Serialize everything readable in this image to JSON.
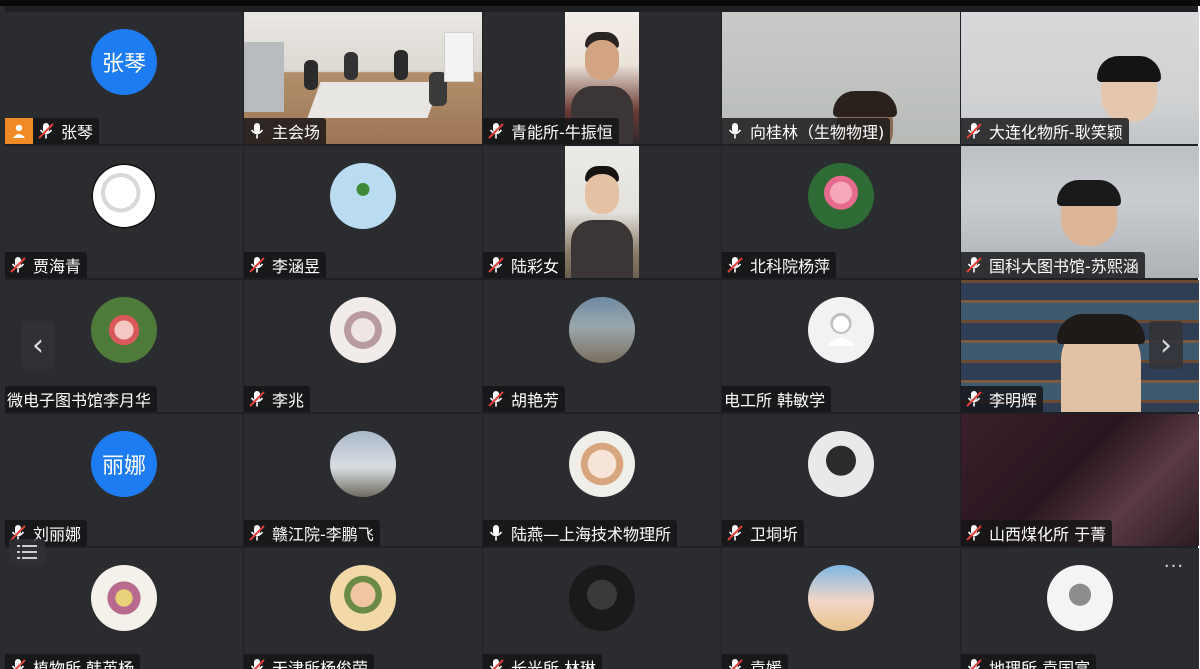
{
  "tiles": [
    {
      "name": "张琴",
      "avatar_text": "张琴",
      "mic": "muted",
      "host": true
    },
    {
      "name": "主会场",
      "mic": "on"
    },
    {
      "name": "青能所-牛振恒",
      "mic": "muted"
    },
    {
      "name": "向桂林（生物物理)",
      "mic": "on"
    },
    {
      "name": "大连化物所-耿笑颖",
      "mic": "muted"
    },
    {
      "name": "贾海青",
      "mic": "muted"
    },
    {
      "name": "李涵昱",
      "mic": "muted"
    },
    {
      "name": "陆彩女",
      "mic": "muted"
    },
    {
      "name": "北科院杨萍",
      "mic": "muted"
    },
    {
      "name": "国科大图书馆-苏熙涵",
      "mic": "muted"
    },
    {
      "name": "微电子图书馆李月华",
      "mic": "none"
    },
    {
      "name": "李兆",
      "mic": "muted"
    },
    {
      "name": "胡艳芳",
      "mic": "muted"
    },
    {
      "name": "电工所 韩敏学",
      "mic": "none"
    },
    {
      "name": "李明辉",
      "mic": "muted"
    },
    {
      "name": "刘丽娜",
      "avatar_text": "丽娜",
      "mic": "muted"
    },
    {
      "name": "赣江院-李鹏飞",
      "mic": "muted"
    },
    {
      "name": "陆燕—上海技术物理所",
      "mic": "on"
    },
    {
      "name": "卫垌圻",
      "mic": "muted"
    },
    {
      "name": "山西煤化所  于菁",
      "mic": "muted"
    },
    {
      "name": "植物所 韩英杨",
      "mic": "muted"
    },
    {
      "name": "天津所杨俊荣",
      "mic": "muted"
    },
    {
      "name": "长光所 林琳",
      "mic": "muted"
    },
    {
      "name": "袁媛",
      "mic": "muted"
    },
    {
      "name": "地理所 袁国富",
      "mic": "muted"
    }
  ],
  "controls": {
    "prev_glyph": "‹",
    "next_glyph": "›",
    "more_glyph": "···"
  },
  "colors": {
    "tile_bg": "#2b2c30",
    "avatar_blue": "#1d7cf2",
    "host_orange": "#f08a24",
    "mute_red": "#e0413a",
    "active_green": "#35b56a"
  }
}
